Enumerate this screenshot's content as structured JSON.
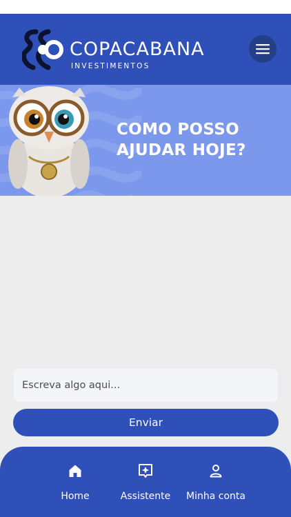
{
  "header": {
    "brand_name": "COPACABANA",
    "brand_subtitle": "INVESTIMENTOS",
    "menu_icon": "hamburger-menu-icon"
  },
  "hero": {
    "title": "COMO POSSO AJUDAR HOJE?",
    "mascot": "owl-mascot"
  },
  "composer": {
    "placeholder": "Escreva algo aqui...",
    "value": "",
    "send_label": "Enviar"
  },
  "bottom_nav": {
    "items": [
      {
        "label": "Home",
        "icon": "home-icon"
      },
      {
        "label": "Assistente",
        "icon": "assistant-sparkle-icon"
      },
      {
        "label": "Minha conta",
        "icon": "user-icon"
      }
    ]
  },
  "colors": {
    "primary": "#2e50b8",
    "hero_background": "#7c98ec",
    "page_background": "#ededed",
    "menu_button": "#253f86"
  }
}
